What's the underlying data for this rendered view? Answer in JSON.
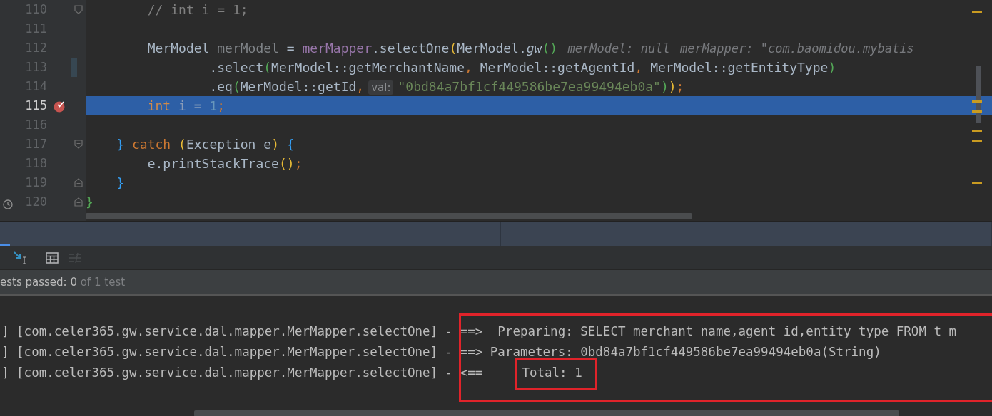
{
  "editor": {
    "lines": [
      {
        "number": "110",
        "current": false,
        "breakpoint": false,
        "changed": false,
        "fold_start": true,
        "fold_end": false,
        "tokens": [
          {
            "kind": "comment",
            "text": "        // int i = 1;"
          }
        ]
      },
      {
        "number": "111",
        "current": false,
        "breakpoint": false,
        "changed": false,
        "fold_start": false,
        "fold_end": false
      },
      {
        "number": "112",
        "current": false,
        "breakpoint": false,
        "changed": false,
        "fold_start": false,
        "fold_end": false,
        "tokens": [
          {
            "kind": "plain",
            "text": "        MerModel "
          },
          {
            "kind": "unused",
            "text": "merModel"
          },
          {
            "kind": "plain",
            "text": " = "
          },
          {
            "kind": "field",
            "text": "merMapper"
          },
          {
            "kind": "plain",
            "text": ".selectOne"
          },
          {
            "kind": "paren_yellow",
            "text": "("
          },
          {
            "kind": "plain",
            "text": "MerModel."
          },
          {
            "kind": "static",
            "text": "gw"
          },
          {
            "kind": "paren_green",
            "text": "()"
          },
          {
            "kind": "hint",
            "text": "merModel: null"
          },
          {
            "kind": "hint",
            "text": "merMapper: \"com.baomidou.mybatis"
          }
        ]
      },
      {
        "number": "113",
        "current": false,
        "breakpoint": false,
        "changed": true,
        "fold_start": false,
        "fold_end": false,
        "tokens": [
          {
            "kind": "plain",
            "text": "                .select"
          },
          {
            "kind": "paren_green",
            "text": "("
          },
          {
            "kind": "plain",
            "text": "MerModel::getMerchantName"
          },
          {
            "kind": "comma",
            "text": ","
          },
          {
            "kind": "plain",
            "text": " MerModel::getAgentId"
          },
          {
            "kind": "comma",
            "text": ","
          },
          {
            "kind": "plain",
            "text": " MerModel::getEntityType"
          },
          {
            "kind": "paren_green",
            "text": ")"
          }
        ]
      },
      {
        "number": "114",
        "current": false,
        "breakpoint": false,
        "changed": false,
        "fold_start": false,
        "fold_end": false,
        "tokens": [
          {
            "kind": "plain",
            "text": "                .eq"
          },
          {
            "kind": "paren_green",
            "text": "("
          },
          {
            "kind": "plain",
            "text": "MerModel::getId"
          },
          {
            "kind": "comma",
            "text": ","
          },
          {
            "kind": "inlay",
            "text": "val:"
          },
          {
            "kind": "string",
            "text": "\"0bd84a7bf1cf449586be7ea99494eb0a\""
          },
          {
            "kind": "paren_green",
            "text": ")"
          },
          {
            "kind": "paren_yellow",
            "text": ")"
          },
          {
            "kind": "comma",
            "text": ";"
          }
        ]
      },
      {
        "number": "115",
        "current": true,
        "breakpoint": true,
        "changed": false,
        "fold_start": false,
        "fold_end": false,
        "tokens": [
          {
            "kind": "keyword",
            "text": "        int"
          },
          {
            "kind": "unused",
            "text": " i"
          },
          {
            "kind": "plain",
            "text": " = "
          },
          {
            "kind": "number",
            "text": "1"
          },
          {
            "kind": "comma",
            "text": ";"
          }
        ]
      },
      {
        "number": "116",
        "current": false,
        "breakpoint": false,
        "changed": false,
        "fold_start": false,
        "fold_end": false
      },
      {
        "number": "117",
        "current": false,
        "breakpoint": false,
        "changed": false,
        "fold_start": true,
        "fold_end": false,
        "tokens": [
          {
            "kind": "paren_blue",
            "text": "    }"
          },
          {
            "kind": "keyword",
            "text": " catch"
          },
          {
            "kind": "paren_yellow",
            "text": " ("
          },
          {
            "kind": "plain",
            "text": "Exception e"
          },
          {
            "kind": "paren_yellow",
            "text": ")"
          },
          {
            "kind": "paren_blue",
            "text": " {"
          }
        ]
      },
      {
        "number": "118",
        "current": false,
        "breakpoint": false,
        "changed": false,
        "fold_start": false,
        "fold_end": false,
        "tokens": [
          {
            "kind": "plain",
            "text": "        e.printStackTrace"
          },
          {
            "kind": "paren_yellow",
            "text": "()"
          },
          {
            "kind": "comma",
            "text": ";"
          }
        ]
      },
      {
        "number": "119",
        "current": false,
        "breakpoint": false,
        "changed": false,
        "fold_start": false,
        "fold_end": true,
        "tokens": [
          {
            "kind": "paren_blue",
            "text": "    }"
          }
        ]
      },
      {
        "number": "120",
        "current": false,
        "breakpoint": false,
        "changed": false,
        "fold_start": false,
        "fold_end": true,
        "tokens": [
          {
            "kind": "paren_green",
            "text": "}"
          }
        ]
      }
    ]
  },
  "panel": {
    "tabs": [
      {
        "selected": true
      },
      {
        "selected": false
      },
      {
        "selected": false
      },
      {
        "selected": false
      },
      {
        "selected": false
      }
    ],
    "toolbar": [
      {
        "kind": "cursor",
        "disabled": false
      },
      {
        "kind": "table",
        "disabled": false
      },
      {
        "kind": "list",
        "disabled": true
      }
    ],
    "status": {
      "passed": "ests passed: 0",
      "total": "of 1 test"
    },
    "console": [
      "] [com.celer365.gw.service.dal.mapper.MerMapper.selectOne] - ==>  Preparing: SELECT merchant_name,agent_id,entity_type FROM t_m",
      "] [com.celer365.gw.service.dal.mapper.MerMapper.selectOne] - ==> Parameters: 0bd84a7bf1cf449586be7ea99494eb0a(String)",
      {
        "text": "] [com.celer365.gw.service.dal.mapper.MerMapper.selectOne] - <==",
        "boxed": "Total: 1"
      }
    ]
  }
}
